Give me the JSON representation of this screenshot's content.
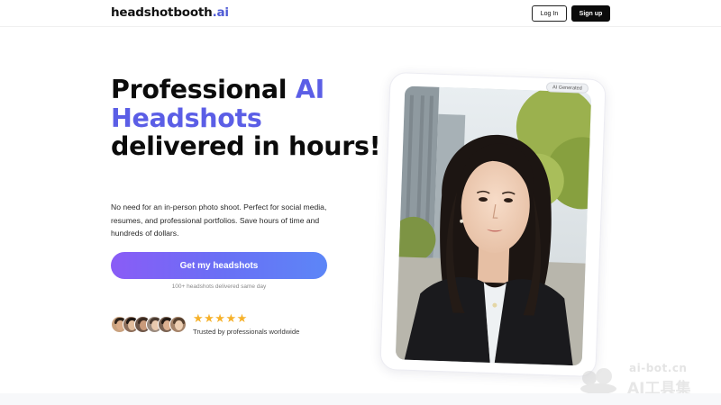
{
  "header": {
    "logo_main": "headshotbooth",
    "logo_suffix": ".ai",
    "login_label": "Log In",
    "signup_label": "Sign up"
  },
  "hero": {
    "headline_part1": "Professional ",
    "headline_accent1": "AI",
    "headline_accent2": "Headshots",
    "headline_part2": "delivered in hours!",
    "subtext": "No need for an in-person photo shoot. Perfect for social media, resumes, and professional portfolios. Save hours of time and hundreds of dollars.",
    "cta_label": "Get my headshots",
    "cta_note": "100+ headshots delivered same day",
    "stars": "★★★★★",
    "trusted_text": "Trusted by professionals worldwide",
    "avatar_count": 6
  },
  "image_card": {
    "badge": "AI Generated",
    "icon": "portrait-photo"
  },
  "watermark": {
    "line1": "ai-bot.cn",
    "line2": "AI工具集"
  },
  "colors": {
    "accent": "#5b5ee6",
    "cta_gradient_start": "#8a5cf6",
    "cta_gradient_end": "#5c86f7",
    "star": "#f6b12a"
  }
}
